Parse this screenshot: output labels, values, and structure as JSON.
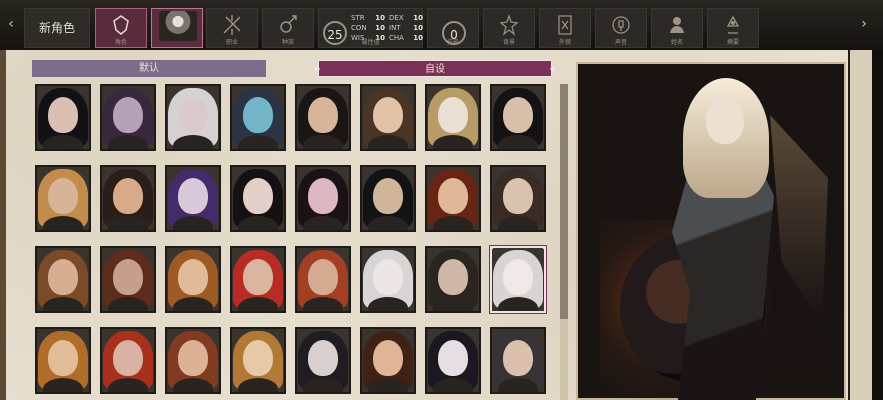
{
  "top_nav": {
    "left_arrow": "‹",
    "right_arrow": "›",
    "new_character": "新角色",
    "tab_labels": [
      "角色",
      "",
      "职业",
      "种族",
      "属性值",
      "技能",
      "背景",
      "外貌",
      "声音",
      "姓名",
      "摘要"
    ],
    "attribute_points": "25",
    "skill_points": "0",
    "stats": [
      {
        "name": "STR",
        "value": "10"
      },
      {
        "name": "DEX",
        "value": "10"
      },
      {
        "name": "CON",
        "value": "10"
      },
      {
        "name": "INT",
        "value": "10"
      },
      {
        "name": "WIS",
        "value": "10"
      },
      {
        "name": "CHA",
        "value": "10"
      }
    ]
  },
  "portrait_buttons": {
    "default": "默认",
    "custom": "自设"
  },
  "portraits": [
    {
      "skin": "#d9c0b2",
      "hair": "#121216"
    },
    {
      "skin": "#b7a1b8",
      "hair": "#37283e"
    },
    {
      "skin": "#dbcaca",
      "hair": "#d6d2d2"
    },
    {
      "skin": "#74b6c9",
      "hair": "#2b3445"
    },
    {
      "skin": "#d8b49b",
      "hair": "#1b1615"
    },
    {
      "skin": "#e3c3a5",
      "hair": "#4a3424"
    },
    {
      "skin": "#eadfd4",
      "hair": "#b89b66"
    },
    {
      "skin": "#d8bfa9",
      "hair": "#151214"
    },
    {
      "skin": "#d7b397",
      "hair": "#c38c4d"
    },
    {
      "skin": "#d8aa8a",
      "hair": "#2b1d18"
    },
    {
      "skin": "#d7c9d8",
      "hair": "#452b6b"
    },
    {
      "skin": "#e2cfc7",
      "hair": "#151112"
    },
    {
      "skin": "#ddb7c1",
      "hair": "#1b1216"
    },
    {
      "skin": "#cfb69a",
      "hair": "#121314"
    },
    {
      "skin": "#e0b899",
      "hair": "#682513"
    },
    {
      "skin": "#d8c3af",
      "hair": "#3a2b24"
    },
    {
      "skin": "#d7ae91",
      "hair": "#7b4a29"
    },
    {
      "skin": "#c59f8b",
      "hair": "#5e2c1c"
    },
    {
      "skin": "#e1bb97",
      "hair": "#9d5a25"
    },
    {
      "skin": "#d9b59f",
      "hair": "#b72d25"
    },
    {
      "skin": "#d4aa93",
      "hair": "#a34023"
    },
    {
      "skin": "#ece7e5",
      "hair": "#d8d5d7"
    },
    {
      "skin": "#cfb7a8",
      "hair": "#2b2520"
    },
    {
      "skin": "#efe8e6",
      "hair": "#d8d4d1"
    },
    {
      "skin": "#e2bc96",
      "hair": "#b06c2b"
    },
    {
      "skin": "#d9b2a3",
      "hair": "#a8301d"
    },
    {
      "skin": "#dcb195",
      "hair": "#823b21"
    },
    {
      "skin": "#e7c8a7",
      "hair": "#b07a36"
    },
    {
      "skin": "#d8d0cf",
      "hair": "#1f1d22"
    },
    {
      "skin": "#dfb497",
      "hair": "#3f2116"
    },
    {
      "skin": "#e5dfe5",
      "hair": "#1b1821"
    },
    {
      "skin": "#dbc0ad",
      "hair": "#383436"
    }
  ],
  "icons": {
    "tab_character": "character-icon",
    "tab_class": "class-icon",
    "tab_race": "race-icon",
    "tab_background": "background-icon",
    "tab_appearance": "appearance-icon",
    "tab_voice": "voice-icon",
    "tab_name": "name-icon",
    "tab_summary": "summary-icon"
  }
}
